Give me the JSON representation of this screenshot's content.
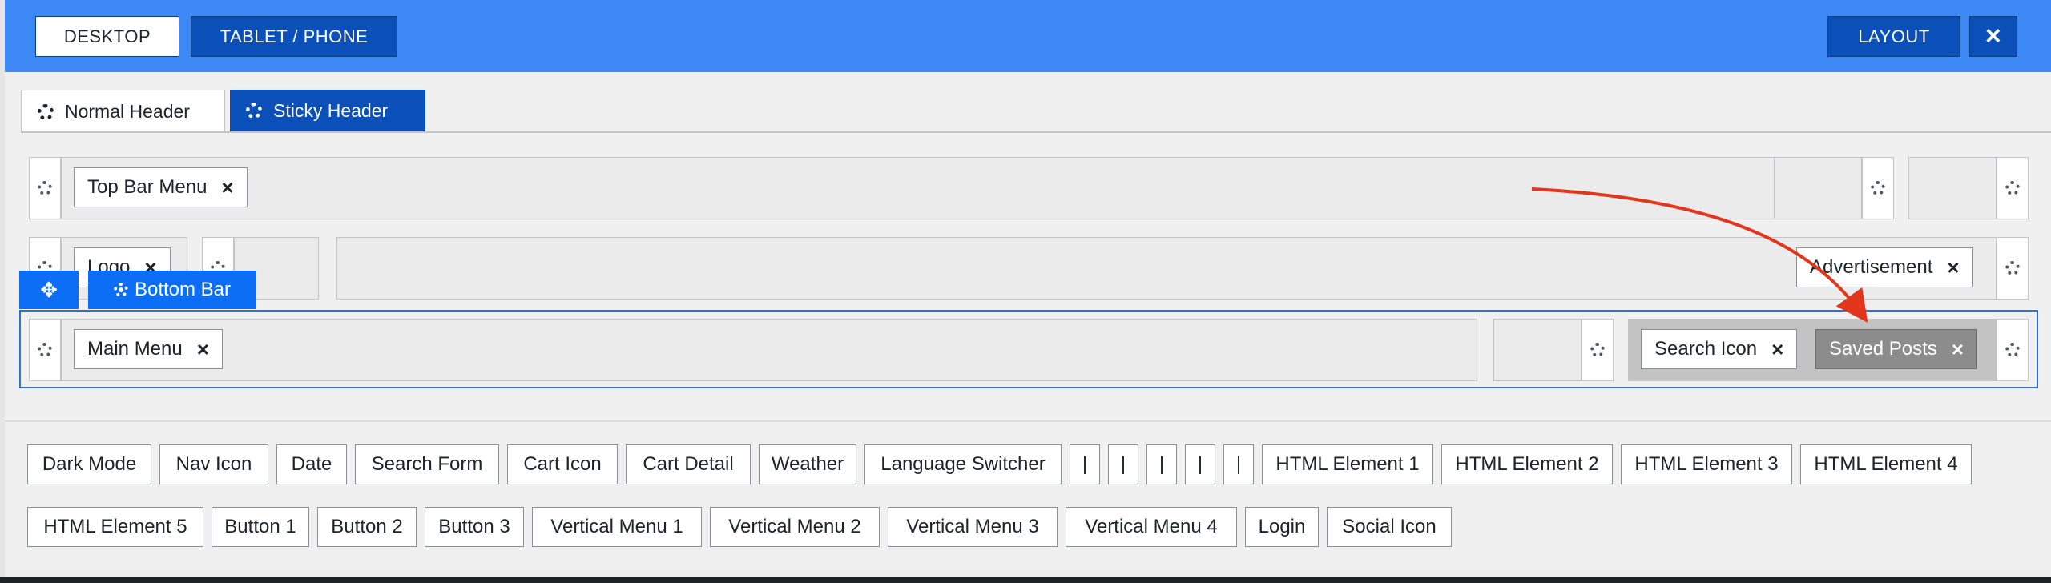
{
  "top_buttons": {
    "desktop": "DESKTOP",
    "tablet_phone": "TABLET / PHONE",
    "layout": "LAYOUT",
    "close": "×"
  },
  "tabs": {
    "normal": "Normal Header",
    "sticky": "Sticky Header"
  },
  "rows": {
    "top": {
      "chip": "Top Bar Menu"
    },
    "main": {
      "chip_logo": "Logo",
      "chip_ad": "Advertisement"
    },
    "bottom": {
      "handle_label": "Bottom Bar",
      "chip_menu": "Main Menu",
      "chip_search": "Search Icon",
      "chip_saved": "Saved Posts"
    }
  },
  "close_mark": "×",
  "pool_row1": [
    "Dark Mode",
    "Nav Icon",
    "Date",
    "Search Form",
    "Cart Icon",
    "Cart Detail",
    "Weather",
    "Language Switcher",
    "|",
    "|",
    "|",
    "|",
    "|",
    "HTML Element 1",
    "HTML Element 2",
    "HTML Element 3",
    "HTML Element 4"
  ],
  "pool_row2": [
    "HTML Element 5",
    "Button 1",
    "Button 2",
    "Button 3",
    "Vertical Menu 1",
    "Vertical Menu 2",
    "Vertical Menu 3",
    "Vertical Menu 4",
    "Login",
    "Social Icon"
  ],
  "colors": {
    "topbar": "#3c89f6",
    "accent": "#0b4fb8",
    "handle": "#0b6ef5",
    "arrow": "#e2361c"
  }
}
